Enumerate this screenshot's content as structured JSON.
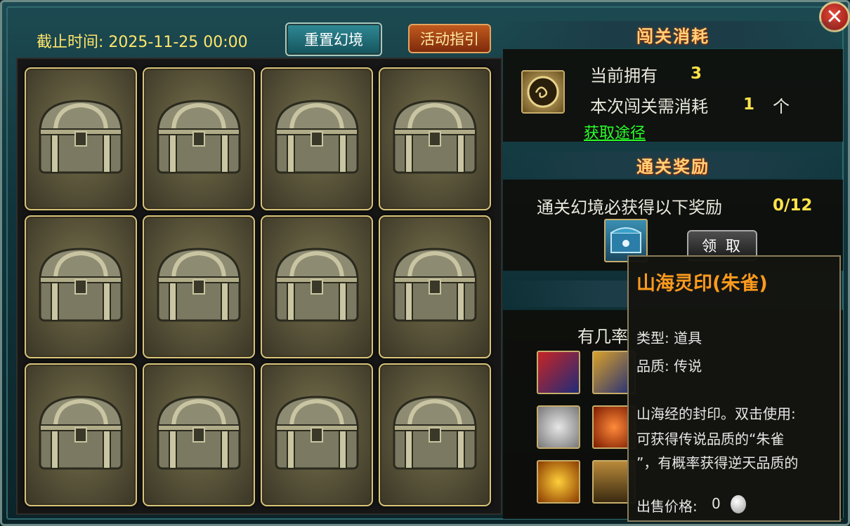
{
  "header": {
    "deadline_label": "截止时间: 2025-11-25 00:00",
    "reset_button": "重置幻境",
    "guide_button": "活动指引",
    "close_icon": "close-icon"
  },
  "grid": {
    "chest_icon": "treasure-chest-icon",
    "cells": [
      "chest",
      "chest",
      "chest",
      "chest",
      "chest",
      "chest",
      "chest",
      "chest",
      "chest",
      "chest",
      "chest",
      "chest"
    ]
  },
  "cost": {
    "title": "闯关消耗",
    "owned_label": "当前拥有",
    "owned_value": "3",
    "need_label": "本次闯关需消耗",
    "need_value": "1",
    "need_unit": "个",
    "acquire_link": "获取途径",
    "item_icon": "seal-coin-icon"
  },
  "reward": {
    "title": "通关奖励",
    "desc": "通关幻境必获得以下奖励",
    "progress": "0/12",
    "chest_icon": "blue-chest-icon",
    "claim_button": "领 取"
  },
  "chance": {
    "label_partial": "有几率",
    "items": [
      "red-chest-icon",
      "fleur-chest-icon",
      "silver-coin-icon",
      "orange-gem-icon",
      "gold-ring-icon",
      "scroll-card-icon"
    ]
  },
  "tooltip": {
    "title": "山海灵印(朱雀)",
    "type_line": "类型: 道具",
    "quality_line": "品质: 传说",
    "desc_line1": "山海经的封印。双击使用:",
    "desc_line2": "可获得传说品质的“朱雀",
    "desc_line3": "”，有概率获得逆天品质的",
    "price_label": "出售价格:",
    "price_value": "0",
    "price_icon": "silver-coin-icon"
  },
  "colors": {
    "highlight_yellow": "#ffe34a",
    "link_green": "#29ff29",
    "tooltip_title": "#ff9a1e"
  }
}
